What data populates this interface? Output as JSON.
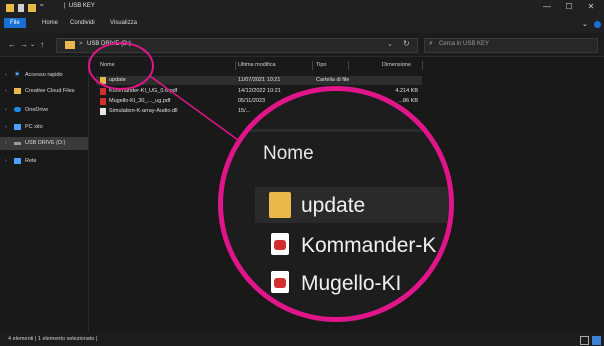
{
  "window": {
    "title": "USB KEY",
    "controls": {
      "minimize": "—",
      "maximize": "☐",
      "close": "✕"
    },
    "qat_sep": "="
  },
  "ribbon": {
    "tabs": [
      {
        "label": "File",
        "active": true
      },
      {
        "label": "Home",
        "active": false
      },
      {
        "label": "Condividi",
        "active": false
      },
      {
        "label": "Visualizza",
        "active": false
      }
    ],
    "expand_icon": "chevron-down-icon",
    "help_icon": "help-icon"
  },
  "nav": {
    "back": "←",
    "forward": "→",
    "recent": "⌄",
    "up": "↑",
    "address": "USB DRIVE (D:)",
    "address_sep": ">",
    "search_placeholder": "Cerca in USB KEY"
  },
  "sidebar": {
    "items": [
      {
        "label": "Accesso rapido",
        "icon": "star-icon",
        "selected": false
      },
      {
        "label": "Creative Cloud Files",
        "icon": "folder-icon",
        "selected": false
      },
      {
        "label": "OneDrive",
        "icon": "cloud-icon",
        "selected": false
      },
      {
        "label": "PC xito",
        "icon": "pc-icon",
        "selected": false
      },
      {
        "label": "USB DRIVE (D:)",
        "icon": "drive-icon",
        "selected": true
      },
      {
        "label": "Rete",
        "icon": "network-icon",
        "selected": false
      }
    ]
  },
  "list": {
    "columns": {
      "name": "Nome",
      "date": "Ultima modifica",
      "type": "Tipo",
      "size": "Dimensione"
    },
    "rows": [
      {
        "name": "update",
        "date": "11/07/2021 10:21",
        "type": "Cartella di file",
        "size": "",
        "icon": "folder-icon",
        "selected": true
      },
      {
        "name": "Kommander-KI_UG_0.6.pdf",
        "date": "14/12/2022 10:21",
        "type": "",
        "size": "4.214 KB",
        "icon": "pdf-icon",
        "selected": false
      },
      {
        "name": "Mugello-KI_30_..._ug.pdf",
        "date": "05/11/2023",
        "type": "",
        "size": "...86 KB",
        "icon": "pdf-icon",
        "selected": false
      },
      {
        "name": "Simulation-K-array-Audio.dll",
        "date": "15/...",
        "type": "",
        "size": "",
        "icon": "file-icon",
        "selected": false
      }
    ]
  },
  "status": {
    "text": "4 elementi | 1 elemento selezionato |"
  },
  "magnifier": {
    "header": "Nome",
    "rows": [
      {
        "name": "update",
        "icon": "folder-icon"
      },
      {
        "name": "Kommander-K",
        "icon": "pdf-icon"
      },
      {
        "name": "Mugello-KI",
        "icon": "pdf-icon"
      }
    ],
    "accent": "#e0158a"
  },
  "colors": {
    "accent": "#1a6fd6",
    "folder": "#e9b949",
    "pdf": "#d32f2f",
    "highlight": "#e0158a"
  }
}
